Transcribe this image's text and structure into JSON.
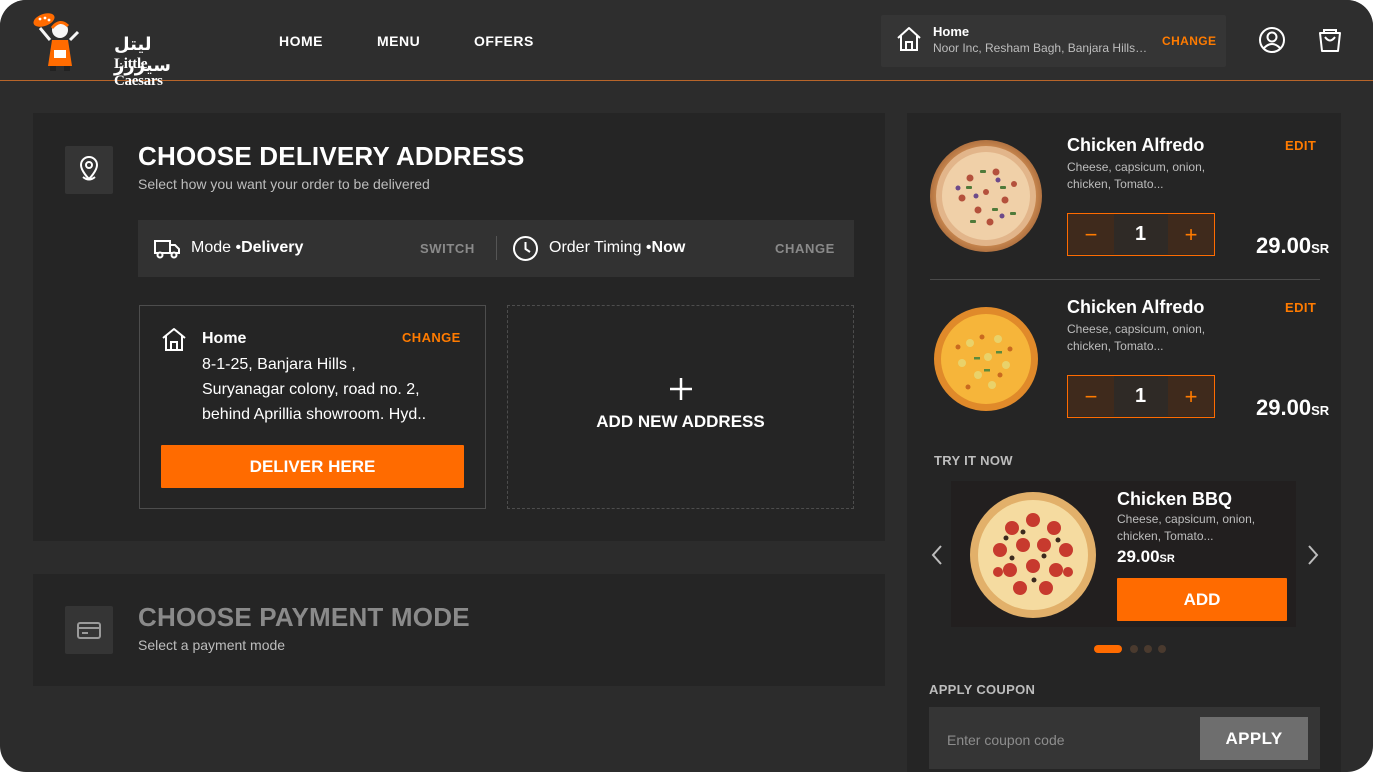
{
  "brand": {
    "name_ar": "ليتل سيزرز",
    "name_en": "Little Caesars"
  },
  "nav": {
    "items": [
      "HOME",
      "MENU",
      "OFFERS"
    ]
  },
  "header_address": {
    "title": "Home",
    "address": "Noor Inc, Resham Bagh, Banjara Hills, Hyderabad",
    "change_label": "CHANGE"
  },
  "delivery": {
    "title": "CHOOSE DELIVERY ADDRESS",
    "subtitle": "Select how you want your order to be delivered",
    "mode_label": "Mode •",
    "mode_value": "Delivery",
    "switch_label": "SWITCH",
    "timing_label": "Order Timing •",
    "timing_value": "Now",
    "timing_change": "CHANGE",
    "saved_address": {
      "title": "Home",
      "change_label": "CHANGE",
      "lines": [
        "8-1-25, Banjara Hills ,",
        "Suryanagar colony, road no. 2,",
        "behind Aprillia showroom. Hyd.."
      ],
      "deliver_button": "DELIVER HERE"
    },
    "add_new_label": "ADD NEW ADDRESS"
  },
  "payment": {
    "title": "CHOOSE PAYMENT MODE",
    "subtitle": "Select a payment mode"
  },
  "cart": {
    "items": [
      {
        "name": "Chicken Alfredo",
        "desc": "Cheese, capsicum, onion, chicken, Tomato...",
        "edit_label": "EDIT",
        "qty": "1",
        "price": "29.00",
        "currency": "SR"
      },
      {
        "name": "Chicken Alfredo",
        "desc": "Cheese, capsicum, onion, chicken, Tomato...",
        "edit_label": "EDIT",
        "qty": "1",
        "price": "29.00",
        "currency": "SR"
      }
    ],
    "try_label": "TRY IT NOW",
    "promo": {
      "name": "Chicken BBQ",
      "desc": "Cheese, capsicum, onion, chicken, Tomato...",
      "price": "29.00",
      "currency": "SR",
      "add_label": "ADD"
    },
    "carousel": {
      "pages": 4,
      "active": 1
    },
    "coupon": {
      "label": "APPLY COUPON",
      "placeholder": "Enter coupon code",
      "apply_label": "APPLY"
    }
  },
  "colors": {
    "accent": "#ff6b00",
    "background": "#2c2c2c",
    "panel": "#252525"
  }
}
